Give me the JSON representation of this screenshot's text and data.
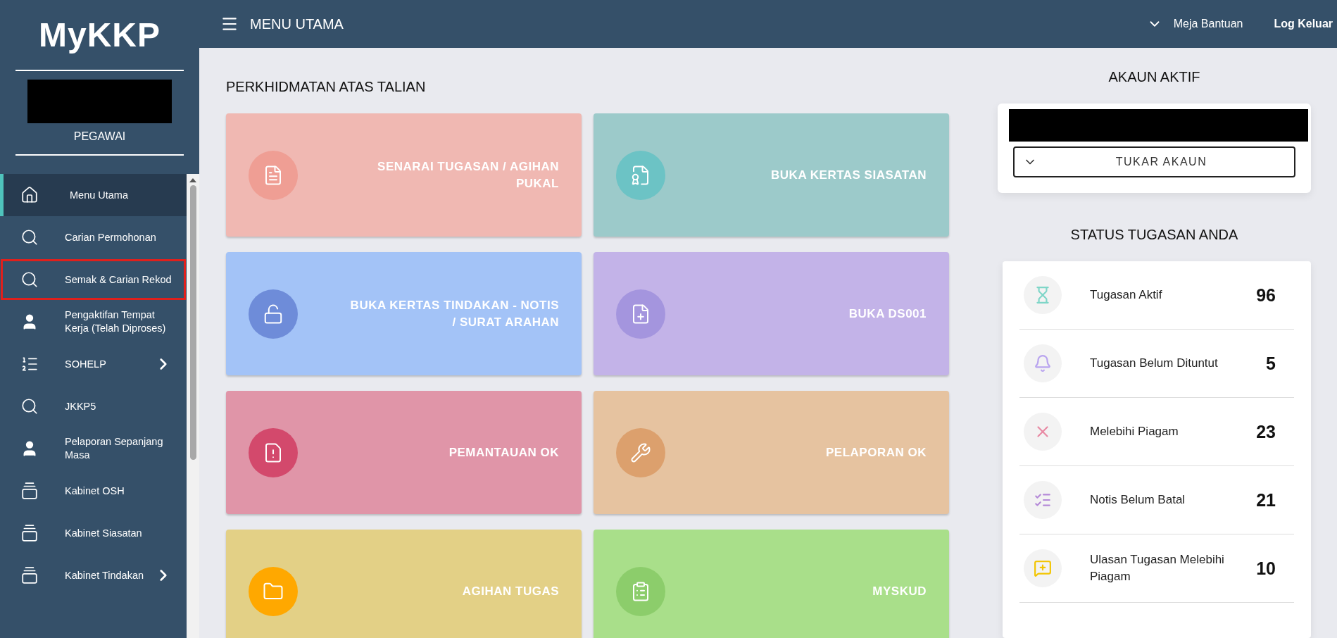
{
  "sidebar": {
    "logo": "MyKKP",
    "role": "PEGAWAI",
    "items": [
      {
        "label": "Menu Utama",
        "selected": true,
        "outlined": false,
        "expandable": false
      },
      {
        "label": "Carian Permohonan",
        "selected": false,
        "outlined": false,
        "expandable": false
      },
      {
        "label": "Semak & Carian Rekod",
        "selected": false,
        "outlined": true,
        "expandable": false
      },
      {
        "label": "Pengaktifan Tempat Kerja (Telah Diproses)",
        "selected": false,
        "outlined": false,
        "expandable": false
      },
      {
        "label": "SOHELP",
        "selected": false,
        "outlined": false,
        "expandable": true
      },
      {
        "label": "JKKP5",
        "selected": false,
        "outlined": false,
        "expandable": false
      },
      {
        "label": "Pelaporan Sepanjang Masa",
        "selected": false,
        "outlined": false,
        "expandable": false
      },
      {
        "label": "Kabinet OSH",
        "selected": false,
        "outlined": false,
        "expandable": false
      },
      {
        "label": "Kabinet Siasatan",
        "selected": false,
        "outlined": false,
        "expandable": false
      },
      {
        "label": "Kabinet Tindakan",
        "selected": false,
        "outlined": false,
        "expandable": true
      }
    ]
  },
  "top_bar": {
    "title": "MENU UTAMA",
    "links": [
      "Meja Bantuan",
      "Log Keluar"
    ]
  },
  "services": {
    "heading": "PERKHIDMATAN ATAS TALIAN",
    "cards": [
      {
        "label": "SENARAI TUGASAN / AGIHAN PUKAL",
        "color": "#f0b8b2",
        "icon": {
          "color": "#ef9e94"
        }
      },
      {
        "label": "BUKA KERTAS SIASATAN",
        "color": "#9ccaca",
        "icon": {
          "color": "#6cc3c5"
        }
      },
      {
        "label": "BUKA KERTAS TINDAKAN - NOTIS / SURAT ARAHAN",
        "color": "#a3c3f7",
        "icon": {
          "color": "#6e8cd9"
        }
      },
      {
        "label": "BUKA DS001",
        "color": "#c3b3e8",
        "icon": {
          "color": "#a495de"
        }
      },
      {
        "label": "PEMANTAUAN OK",
        "color": "#e095a8",
        "icon": {
          "color": "#d3496c"
        }
      },
      {
        "label": "PELAPORAN OK",
        "color": "#e6c3a0",
        "icon": {
          "color": "#dca06d"
        }
      },
      {
        "label": "AGIHAN TUGAS",
        "color": "#e3d086",
        "icon": {
          "color": "#ffa800"
        }
      },
      {
        "label": "MYSKUD",
        "color": "#a9df8a",
        "icon": {
          "color": "#8ccd6b"
        }
      }
    ]
  },
  "account": {
    "heading": "AKAUN AKTIF",
    "button": "TUKAR AKAUN"
  },
  "task_status": {
    "heading": "STATUS TUGASAN ANDA",
    "rows": [
      {
        "label": "Tugasan Aktif",
        "count": "96",
        "color": "#7fd6c8"
      },
      {
        "label": "Tugasan Belum Dituntut",
        "count": "5",
        "color": "#b9a4ef"
      },
      {
        "label": "Melebihi Piagam",
        "count": "23",
        "color": "#e88aa4"
      },
      {
        "label": "Notis Belum Batal",
        "count": "21",
        "color": "#b58ad8"
      },
      {
        "label": "Ulasan Tugasan Melebihi Piagam",
        "count": "10",
        "color": "#f2c500"
      }
    ]
  }
}
